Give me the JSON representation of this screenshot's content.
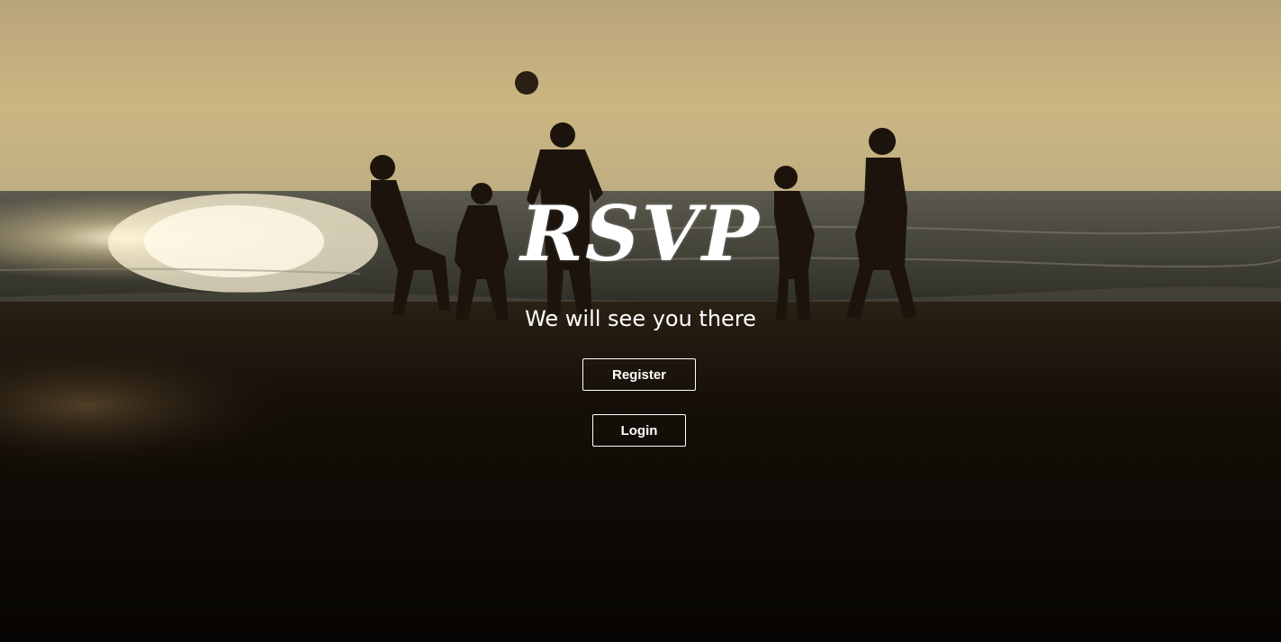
{
  "hero": {
    "title": "RSVP",
    "subtitle": "We will see you there",
    "background_image": "beach-sunset-silhouettes-photo"
  },
  "actions": {
    "register_label": "Register",
    "login_label": "Login"
  },
  "colors": {
    "text": "#ffffff",
    "button_border": "#ffffff",
    "sky": "#c4b07a",
    "sand": "#0b0703"
  }
}
